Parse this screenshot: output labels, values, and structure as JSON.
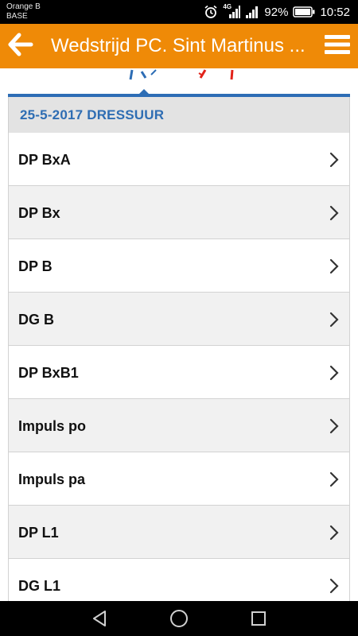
{
  "status_bar": {
    "carrier_line1": "Orange B",
    "carrier_line2": "BASE",
    "network": "4G",
    "battery": "92%",
    "time": "10:52"
  },
  "app_bar": {
    "title": "Wedstrijd PC. Sint Martinus ...",
    "back_icon": "arrow-left-icon",
    "menu_icon": "hamburger-menu-icon",
    "color": "#ef8a07"
  },
  "section": {
    "title": "25-5-2017 DRESSUUR",
    "accent": "#2d6db5"
  },
  "items": [
    {
      "label": "DP BxA"
    },
    {
      "label": "DP Bx"
    },
    {
      "label": "DP B"
    },
    {
      "label": "DG B"
    },
    {
      "label": "DP BxB1"
    },
    {
      "label": "Impuls po"
    },
    {
      "label": "Impuls pa"
    },
    {
      "label": "DP L1"
    },
    {
      "label": "DG L1"
    }
  ],
  "nav": {
    "back_icon": "triangle-back-icon",
    "home_icon": "circle-home-icon",
    "recents_icon": "square-recents-icon"
  }
}
